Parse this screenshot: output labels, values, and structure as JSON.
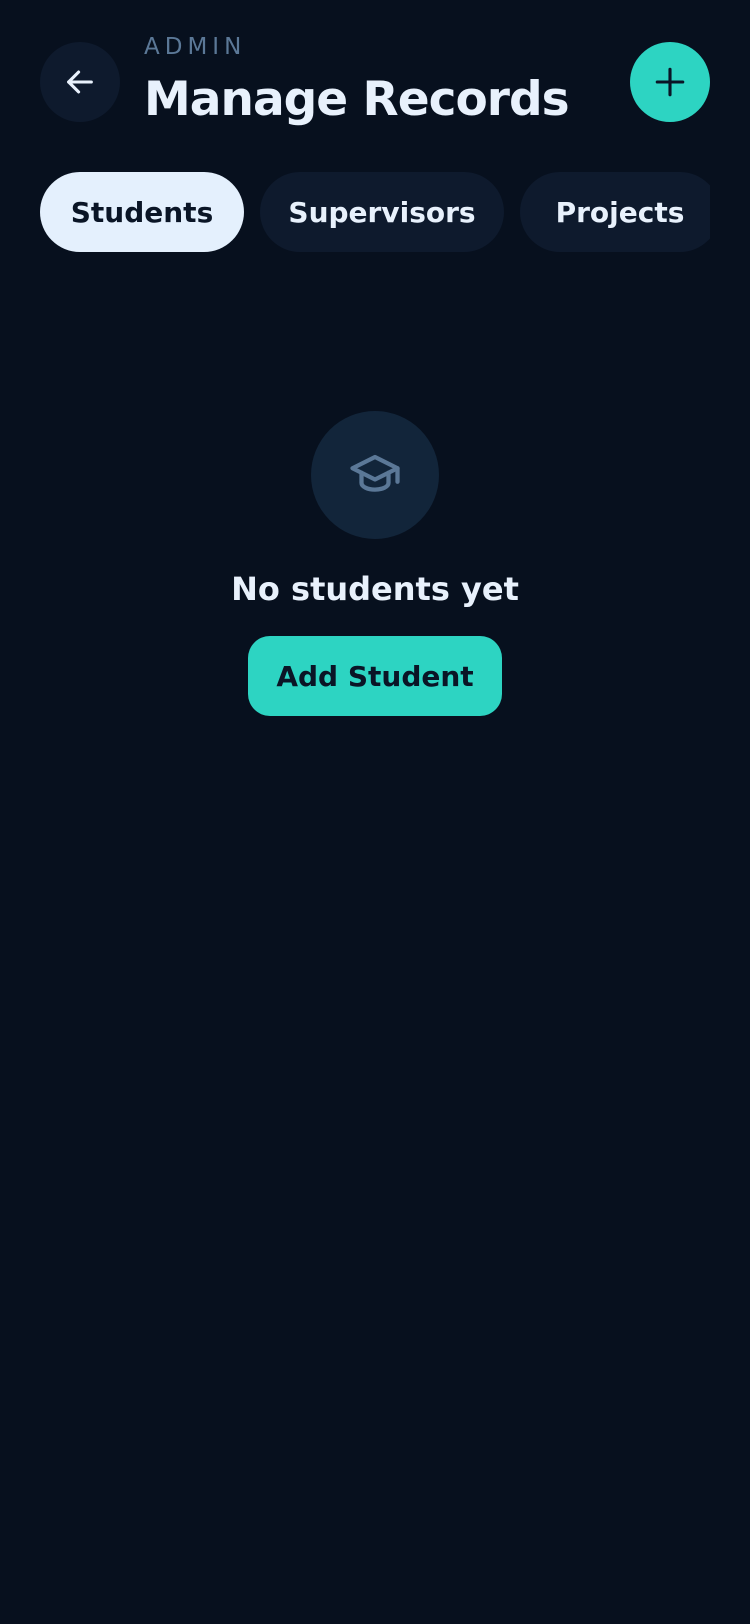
{
  "header": {
    "eyebrow": "ADMIN",
    "title": "Manage Records",
    "back_icon": "arrow-left-icon",
    "add_icon": "plus-icon"
  },
  "tabs": [
    {
      "label": "Students",
      "active": true
    },
    {
      "label": "Supervisors",
      "active": false
    },
    {
      "label": "Projects",
      "active": false
    }
  ],
  "empty_state": {
    "icon": "graduation-cap-icon",
    "title": "No students yet",
    "button_label": "Add Student"
  },
  "colors": {
    "background": "#07101e",
    "surface": "#0e1a2d",
    "accent": "#2dd4c2",
    "text": "#e8f1fc",
    "muted": "#5b7897",
    "active_tab": "#e4f0fd"
  }
}
